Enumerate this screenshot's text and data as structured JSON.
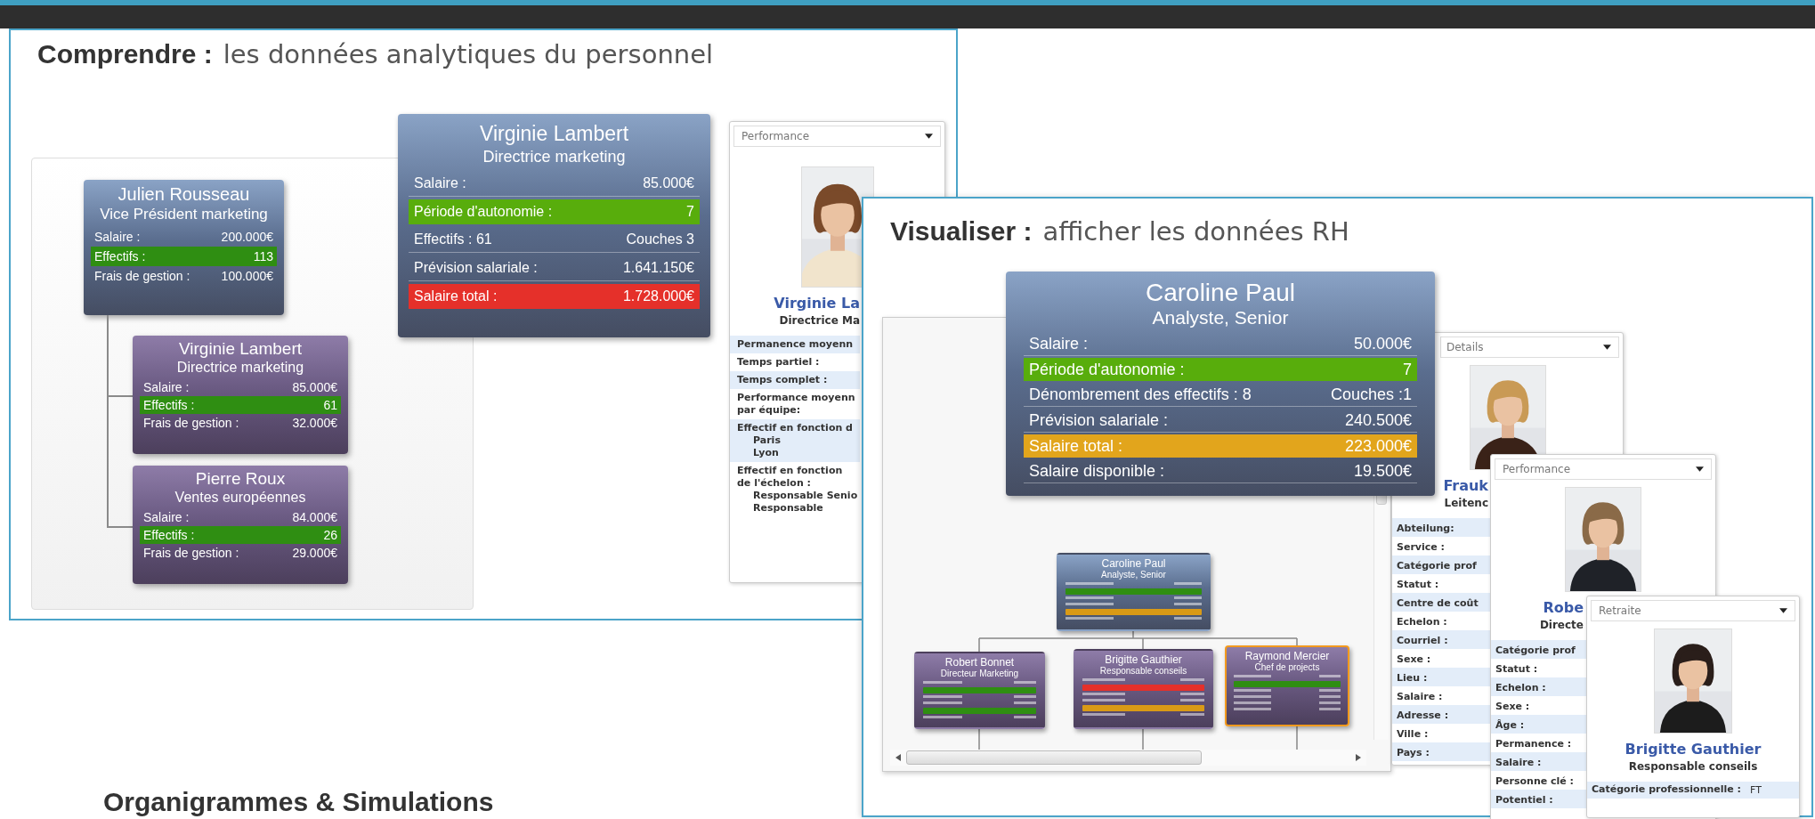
{
  "comprendre": {
    "heading": "Comprendre :",
    "subheading": "les données analytiques du personnel",
    "org_chart": {
      "name": "Julien Rousseau",
      "title": "Vice Président marketing",
      "rows": [
        {
          "label": "Salaire :",
          "value": "200.000€"
        },
        {
          "label": "Effectifs :",
          "value": "113",
          "color": "#2f8e12"
        },
        {
          "label": "Frais de gestion :",
          "value": "100.000€"
        }
      ],
      "children": [
        {
          "name": "Virginie Lambert",
          "title": "Directrice marketing",
          "rows": [
            {
              "label": "Salaire :",
              "value": "85.000€"
            },
            {
              "label": "Effectifs :",
              "value": "61",
              "color": "#2f8e12"
            },
            {
              "label": "Frais de gestion :",
              "value": "32.000€"
            }
          ]
        },
        {
          "name": "Pierre Roux",
          "title": "Ventes européennes",
          "rows": [
            {
              "label": "Salaire :",
              "value": "84.000€"
            },
            {
              "label": "Effectifs :",
              "value": "26",
              "color": "#2f8e12"
            },
            {
              "label": "Frais de gestion :",
              "value": "29.000€"
            }
          ]
        }
      ]
    },
    "detail_card": {
      "name": "Virginie Lambert",
      "title": "Directrice marketing",
      "rows": [
        {
          "label": "Salaire :",
          "value": "85.000€"
        },
        {
          "label": "Période d'autonomie :",
          "value": "7",
          "color": "#58ad0c"
        },
        {
          "label": "Effectifs : 61",
          "value": "Couches 3"
        },
        {
          "label": "Prévision salariale :",
          "value": "1.641.150€"
        },
        {
          "label": "Salaire total :",
          "value": "1.728.000€",
          "color": "#e5302a"
        }
      ]
    },
    "profile": {
      "dropdown": "Performance",
      "name": "Virginie La",
      "title": "Directrice Ma",
      "fields": [
        {
          "lines": [
            "Permanence moyenn"
          ]
        },
        {
          "lines": [
            "Temps partiel :"
          ]
        },
        {
          "lines": [
            "Temps complet :"
          ]
        },
        {
          "lines": [
            "Performance moyenn",
            "par équipe:"
          ]
        },
        {
          "lines": [
            "Effectif en fonction  d"
          ],
          "children": [
            "Paris",
            "Lyon"
          ]
        },
        {
          "lines": [
            "Effectif en fonction",
            "de l'échelon :"
          ],
          "children": [
            "Responsable Senio",
            "Responsable"
          ]
        }
      ]
    }
  },
  "visualiser": {
    "heading": "Visualiser :",
    "subheading": "afficher les données RH",
    "detail_card": {
      "name": "Caroline Paul",
      "title": "Analyste, Senior",
      "rows": [
        {
          "label": "Salaire :",
          "value": "50.000€"
        },
        {
          "label": "Période d'autonomie :",
          "value": "7",
          "color": "#58ad0c"
        },
        {
          "label": "Dénombrement des effectifs : 8",
          "value": "Couches :1"
        },
        {
          "label": "Prévision salariale :",
          "value": "240.500€"
        },
        {
          "label": "Salaire total :",
          "value": "223.000€",
          "color": "#e2a51c"
        },
        {
          "label": "Salaire disponible :",
          "value": "19.500€"
        }
      ]
    },
    "org_chart": {
      "name": "Caroline Paul",
      "title": "Analyste, Senior",
      "selected": false,
      "bars": [
        {
          "kind": "text"
        },
        {
          "kind": "highlight",
          "color": "#2f8e12"
        },
        {
          "kind": "text"
        },
        {
          "kind": "text"
        },
        {
          "kind": "highlight",
          "color": "#d99a16"
        },
        {
          "kind": "text"
        }
      ],
      "children": [
        {
          "name": "Robert Bonnet",
          "title": "Directeur Marketing",
          "selected": false,
          "bars": [
            {
              "kind": "text"
            },
            {
              "kind": "highlight",
              "color": "#2f8e12"
            },
            {
              "kind": "text"
            },
            {
              "kind": "text"
            },
            {
              "kind": "highlight",
              "color": "#2f8e12"
            },
            {
              "kind": "text"
            }
          ]
        },
        {
          "name": "Brigitte Gauthier",
          "title": "Responsable conseils",
          "selected": false,
          "bars": [
            {
              "kind": "text"
            },
            {
              "kind": "highlight",
              "color": "#e5302a"
            },
            {
              "kind": "text"
            },
            {
              "kind": "text"
            },
            {
              "kind": "highlight",
              "color": "#d99a16"
            },
            {
              "kind": "text"
            }
          ]
        },
        {
          "name": "Raymond Mercier",
          "title": "Chef de projects",
          "selected": true,
          "bars": [
            {
              "kind": "text"
            },
            {
              "kind": "highlight",
              "color": "#2f8e12"
            },
            {
              "kind": "text"
            },
            {
              "kind": "text"
            },
            {
              "kind": "text"
            },
            {
              "kind": "text"
            }
          ]
        }
      ]
    },
    "profiles": [
      {
        "dropdown": "Details",
        "name": "Frauk",
        "title": "Leitenc",
        "fields": [
          {
            "label": "Abteilung:"
          },
          {
            "label": "Service :"
          },
          {
            "label": "Catégorie prof"
          },
          {
            "label": "Statut :"
          },
          {
            "label": "Centre de coût"
          },
          {
            "label": "Echelon :"
          },
          {
            "label": "Courriel :"
          },
          {
            "label": "Sexe :"
          },
          {
            "label": "Lieu :"
          },
          {
            "label": "Salaire :"
          },
          {
            "label": "Adresse :"
          },
          {
            "label": "Ville :"
          },
          {
            "label": "Pays :"
          }
        ]
      },
      {
        "dropdown": "Performance",
        "name": "Robe",
        "title": "Directe",
        "fields": [
          {
            "label": "Catégorie prof"
          },
          {
            "label": "Statut :"
          },
          {
            "label": "Echelon :"
          },
          {
            "label": "Sexe :"
          },
          {
            "label": "Âge :"
          },
          {
            "label": "Permanence :"
          },
          {
            "label": "Salaire :"
          },
          {
            "label": "Personne clé :"
          },
          {
            "label": "Potentiel :"
          }
        ]
      },
      {
        "dropdown": "Retraite",
        "name": "Brigitte Gauthier",
        "title": "Responsable conseils",
        "fields": [
          {
            "label": "Catégorie professionnelle :",
            "value": "FT"
          }
        ]
      }
    ]
  },
  "footer_title": "Organigrammes & Simulations"
}
